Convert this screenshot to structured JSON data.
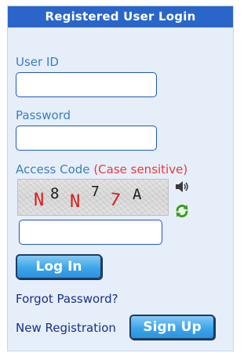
{
  "header": {
    "title": "Registered User Login"
  },
  "form": {
    "user_id_label": "User ID",
    "user_id_value": "",
    "password_label": "Password",
    "password_value": "",
    "access_code_label": "Access Code",
    "access_code_note": "(Case sensitive)",
    "access_code_value": ""
  },
  "captcha": {
    "characters": [
      {
        "char": "N",
        "color": "#d42020"
      },
      {
        "char": "8",
        "color": "#1c1c1c"
      },
      {
        "char": "N",
        "color": "#d42020"
      },
      {
        "char": "7",
        "color": "#1c1c1c"
      },
      {
        "char": "7",
        "color": "#d42020"
      },
      {
        "char": "A",
        "color": "#1c1c1c"
      }
    ],
    "audio_icon": "speaker-icon",
    "refresh_icon": "refresh-icon"
  },
  "actions": {
    "login_label": "Log In",
    "forgot_password_label": "Forgot Password?",
    "new_registration_label": "New Registration",
    "signup_label": "Sign Up"
  },
  "colors": {
    "header_bg": "#2a66c9",
    "panel_bg": "#e6eef9",
    "label_blue": "#3a7fc0",
    "warning_red": "#e33b3b",
    "link_navy": "#1a2f8a",
    "button_blue": "#3da6ea"
  }
}
